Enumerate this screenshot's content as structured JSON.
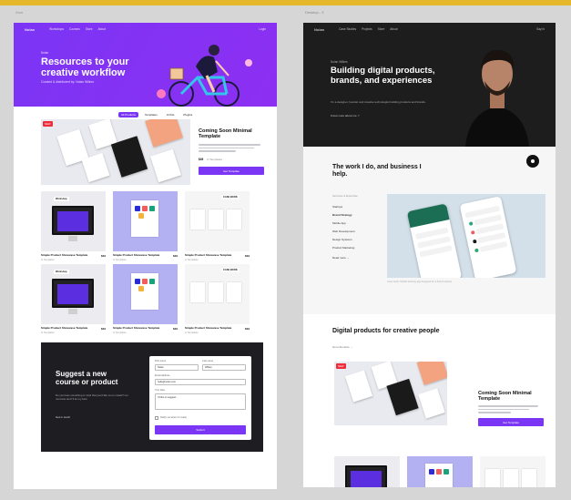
{
  "left_caption": "Xcm",
  "right_caption": "Desktop - 3",
  "left": {
    "nav": {
      "logo": "Nolan",
      "links": [
        "Workshops",
        "Courses",
        "Store",
        "About"
      ],
      "right": "Login"
    },
    "hero": {
      "kicker": "Nolan",
      "title": "Resources to your creative workflow",
      "subtitle": "Curated & distributed by: Nolan Wilkes"
    },
    "tabs": [
      "All Products",
      "Templates",
      "Ui Kits",
      "Plugins"
    ],
    "featured": {
      "badge": "NEW",
      "title": "Coming Soon Minimal Template",
      "price": "$49",
      "meta": "In Templates",
      "button": "Get Template"
    },
    "cards": [
      {
        "title": "Simple Product Showcase Template",
        "price": "$49",
        "sub": "In Templates",
        "tag": "Workshop"
      },
      {
        "title": "Simple Product Showcase Template",
        "price": "$49",
        "sub": "In Templates",
        "tag": ""
      },
      {
        "title": "Simple Product Showcase Template",
        "price": "$49",
        "sub": "In Templates",
        "tag": "CASE BOOK"
      },
      {
        "title": "Simple Product Showcase Template",
        "price": "$49",
        "sub": "In Templates",
        "tag": "Workshop"
      },
      {
        "title": "Simple Product Showcase Template",
        "price": "$49",
        "sub": "In Templates",
        "tag": ""
      },
      {
        "title": "Simple Product Showcase Template",
        "price": "$49",
        "sub": "In Templates",
        "tag": "CASE BOOK"
      }
    ],
    "suggest": {
      "title": "Suggest a new course or product",
      "text": "Do you have something in mind that you'd like me to create? Let me know and I'll do my best.",
      "link": "Get in touch",
      "form": {
        "first_label": "First name",
        "first_value": "Nolan",
        "last_label": "Last name",
        "last_value": "Wilkes",
        "email_label": "Email address",
        "email_value": "hello@nolan.com",
        "idea_label": "Your idea",
        "idea_value": "I'd like to suggest...",
        "check_label": "Notify me when it's ready",
        "button": "Submit"
      }
    }
  },
  "right": {
    "nav": {
      "logo": "Nolan",
      "links": [
        "Case Studies",
        "Projects",
        "Store",
        "About"
      ],
      "right": "Say hi"
    },
    "hero": {
      "kicker": "Nolan Wilkes",
      "title": "Building digital products, brands, and experiences",
      "subtitle": "I'm a designer, founder and creative technologist building products and brands.",
      "link": "Know more about me ↗"
    },
    "work": {
      "title": "The work I do, and business I help.",
      "list_label": "Services & Expertise",
      "items": [
        "Startups",
        "Brand Strategy",
        "Mobile App",
        "Web Development",
        "Design Systems",
        "Product Marketing"
      ],
      "more": "Read more →",
      "caption": "Case study: Mobile banking app designed for a fintech startup."
    },
    "digital": {
      "title": "Digital products for creative people",
      "subtitle": "Go to the store →",
      "featured": {
        "badge": "NEW",
        "title": "Coming Soon Minimal Template",
        "button": "Get Template"
      }
    }
  }
}
